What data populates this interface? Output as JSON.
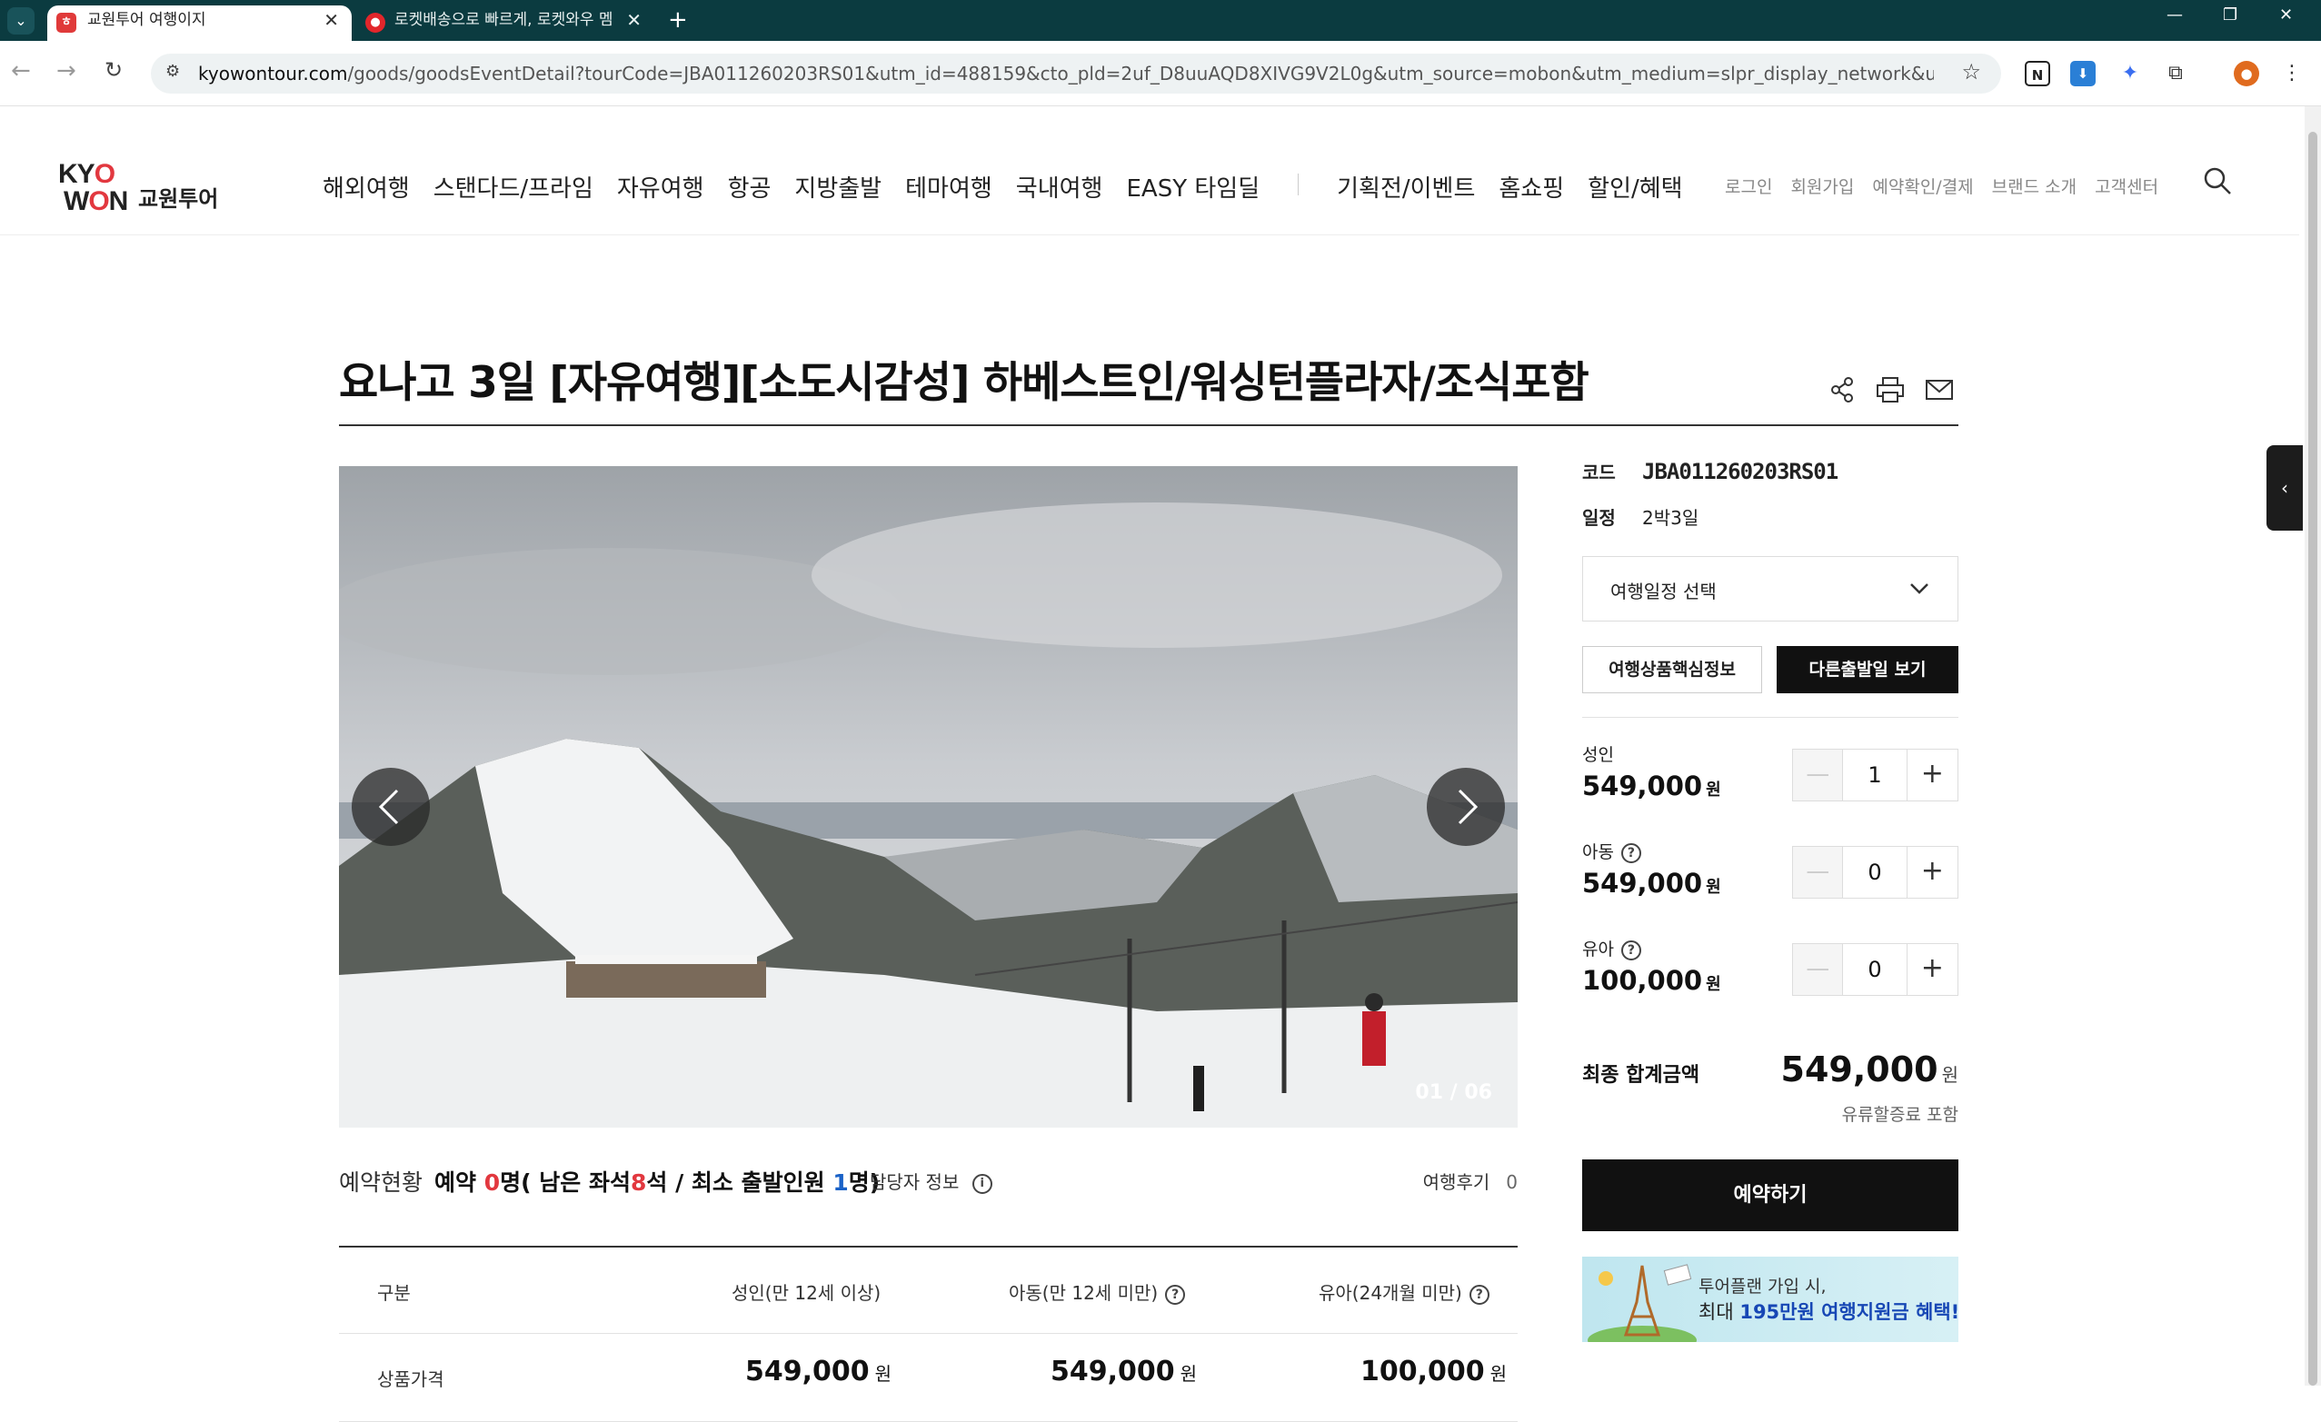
{
  "browser": {
    "tabs": [
      {
        "title": "교원투어 여행이지",
        "active": true
      },
      {
        "title": "로켓배송으로 빠르게, 로켓와우 멤",
        "active": false
      }
    ],
    "url_host": "kyowontour.com",
    "url_path": "/goods/goodsEventDetail?tourCode=JBA011260203RS01&utm_id=488159&cto_pld=2uf_D8uuAQD8XIVG9V2L0g&utm_source=mobon&utm_medium=slpr_display_network&utm_campaign=icover"
  },
  "site": {
    "logo_en_1": "KYO",
    "logo_en_2": "WON",
    "logo_ko": "교원투어",
    "gnb": [
      "해외여행",
      "스탠다드/프라임",
      "자유여행",
      "항공",
      "지방출발",
      "테마여행",
      "국내여행",
      "EASY 타임딜"
    ],
    "gnb2": [
      "기획전/이벤트",
      "홈쇼핑",
      "할인/혜택"
    ],
    "util": [
      "로그인",
      "회원가입",
      "예약확인/결제",
      "브랜드 소개",
      "고객센터"
    ]
  },
  "product": {
    "title": "요나고 3일 [자유여행][소도시감성] 하베스트인/워싱턴플라자/조식포함",
    "image_counter": "01 / 06",
    "status_label": "예약현황",
    "status_prefix": "예약 ",
    "reserved": "0",
    "status_mid": "명( 남은 좌석",
    "seats_left": "8",
    "status_mid2": "석 / 최소 출발인원 ",
    "min_people": "1",
    "status_end": "명)",
    "manager_info": "담당자 정보",
    "review_label": "여행후기",
    "review_count": "0"
  },
  "price_table": {
    "headers": [
      "구분",
      "성인(만 12세 이상)",
      "아동(만 12세 미만)",
      "유아(24개월 미만)"
    ],
    "row_label": "상품가격",
    "prices": [
      "549,000",
      "549,000",
      "100,000"
    ],
    "unit": "원"
  },
  "panel": {
    "code_label": "코드",
    "code_value": "JBA011260203RS01",
    "schedule_label": "일정",
    "schedule_value": "2박3일",
    "select_placeholder": "여행일정 선택",
    "btn_core_info": "여행상품핵심정보",
    "btn_other_dates": "다른출발일 보기",
    "passengers": [
      {
        "name": "성인",
        "price": "549,000",
        "count": "1"
      },
      {
        "name": "아동",
        "price": "549,000",
        "count": "0"
      },
      {
        "name": "유아",
        "price": "100,000",
        "count": "0"
      }
    ],
    "unit": "원",
    "total_label": "최종 합계금액",
    "total_value": "549,000",
    "total_note": "유류할증료 포함",
    "reserve_btn": "예약하기",
    "banner_line1": "투어플랜 가입 시,",
    "banner_line2_pre": "최대 ",
    "banner_line2_bold": "195만원 여행지원금 혜택!"
  },
  "colors": {
    "brand_red": "#e2383f",
    "accent_blue": "#1a62c7",
    "dark": "#111111"
  }
}
